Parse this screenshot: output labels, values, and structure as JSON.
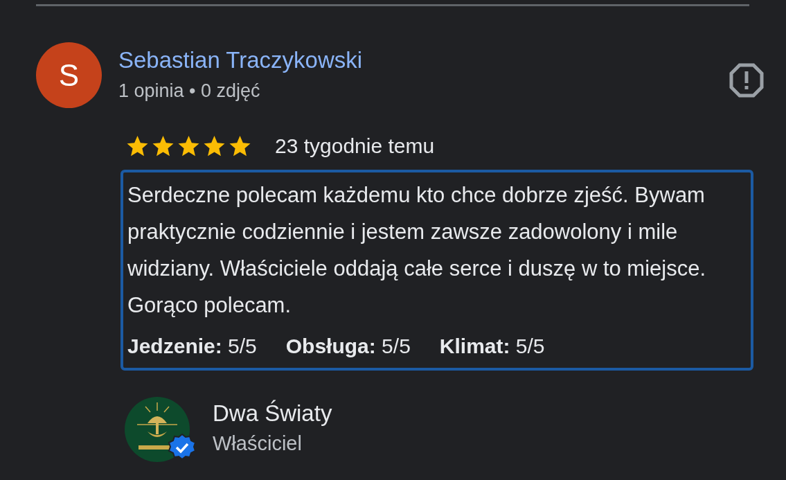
{
  "review": {
    "author": {
      "initial": "S",
      "name": "Sebastian Traczykowski",
      "meta": "1 opinia • 0 zdjęć"
    },
    "stars": 5,
    "time": "23 tygodnie temu",
    "text": "Serdeczne polecam każdemu kto chce dobrze zjeść. Bywam praktycznie codziennie i jestem zawsze zadowolony i mile widziany. Właściciele oddają całe serce i duszę w to miejsce. Gorąco polecam.",
    "ratings": [
      {
        "label": "Jedzenie:",
        "value": "5/5"
      },
      {
        "label": "Obsługa:",
        "value": "5/5"
      },
      {
        "label": "Klimat:",
        "value": "5/5"
      }
    ],
    "selected": true
  },
  "owner_reply": {
    "name": "Dwa Światy",
    "role": "Właściciel",
    "verified": true
  }
}
